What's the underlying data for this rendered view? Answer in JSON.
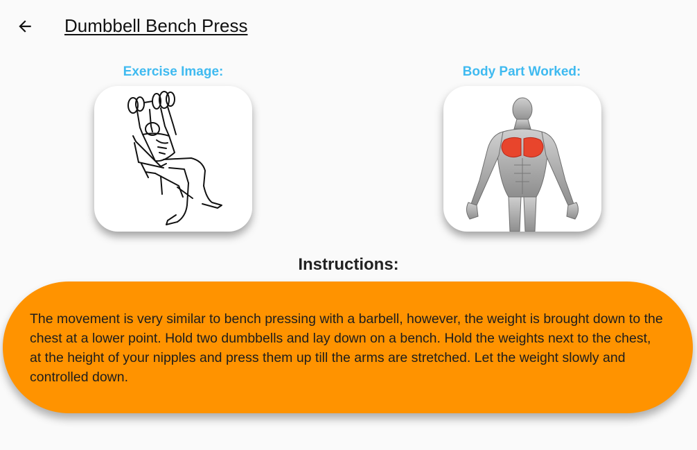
{
  "header": {
    "title": "Dumbbell Bench Press",
    "back_icon": "arrow-left-icon"
  },
  "exercise_image": {
    "label": "Exercise Image:",
    "icon": "bench-press-illustration"
  },
  "body_part": {
    "label": "Body Part Worked:",
    "icon": "chest-muscle-anatomy"
  },
  "instructions": {
    "title": "Instructions:",
    "text": "The movement is very similar to bench pressing with a barbell, however, the weight is brought down to the chest at a lower point. Hold two dumbbells and lay down on a bench. Hold the weights next to the chest, at the height of your nipples and press them up till the arms are stretched. Let the weight slowly and controlled down."
  },
  "colors": {
    "accent_label": "#3fbaf0",
    "instructions_bg": "#ff9300",
    "muscle_highlight": "#e8452c"
  }
}
